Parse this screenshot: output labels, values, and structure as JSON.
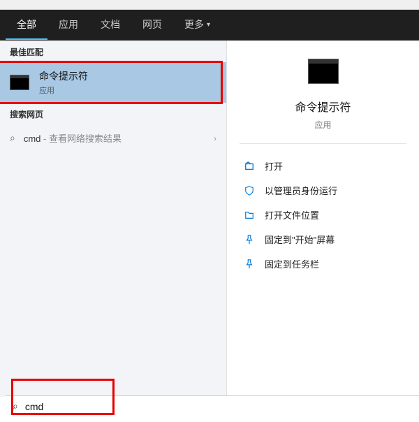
{
  "tabs": {
    "all": "全部",
    "apps": "应用",
    "docs": "文档",
    "web": "网页",
    "more": "更多"
  },
  "sections": {
    "best_match": "最佳匹配",
    "search_web": "搜索网页"
  },
  "best_match_result": {
    "title": "命令提示符",
    "subtitle": "应用"
  },
  "web_result": {
    "query": "cmd",
    "suffix": " - 查看网络搜索结果"
  },
  "preview": {
    "title": "命令提示符",
    "subtitle": "应用"
  },
  "actions": {
    "open": "打开",
    "run_admin": "以管理员身份运行",
    "open_location": "打开文件位置",
    "pin_start": "固定到\"开始\"屏幕",
    "pin_taskbar": "固定到任务栏"
  },
  "search": {
    "value": "cmd"
  }
}
